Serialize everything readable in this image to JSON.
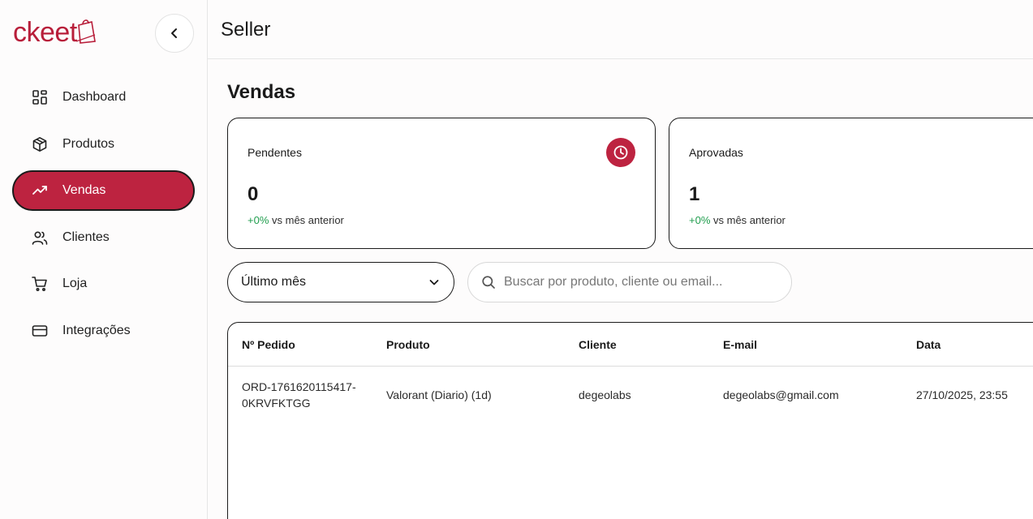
{
  "brand": {
    "name": "ckeet",
    "accent": "#bd2340"
  },
  "sidebar": {
    "items": [
      {
        "label": "Dashboard",
        "icon": "dashboard-icon"
      },
      {
        "label": "Produtos",
        "icon": "package-icon"
      },
      {
        "label": "Vendas",
        "icon": "trending-up-icon",
        "active": true
      },
      {
        "label": "Clientes",
        "icon": "users-icon"
      },
      {
        "label": "Loja",
        "icon": "cart-icon"
      },
      {
        "label": "Integrações",
        "icon": "credit-card-icon"
      }
    ]
  },
  "header": {
    "title": "Seller"
  },
  "main": {
    "title": "Vendas",
    "cards": [
      {
        "label": "Pendentes",
        "value": "0",
        "delta": "+0%",
        "delta_suffix": "vs mês anterior",
        "icon": "clock-icon"
      },
      {
        "label": "Aprovadas",
        "value": "1",
        "delta": "+0%",
        "delta_suffix": "vs mês anterior"
      }
    ],
    "filter": {
      "selected": "Último mês"
    },
    "search": {
      "placeholder": "Buscar por produto, cliente ou email..."
    },
    "table": {
      "columns": [
        "Nº Pedido",
        "Produto",
        "Cliente",
        "E-mail",
        "Data"
      ],
      "rows": [
        {
          "order_line1": "ORD-1761620115417-",
          "order_line2": "0KRVFKTGG",
          "product": "Valorant (Diario) (1d)",
          "client": "degeolabs",
          "email": "degeolabs@gmail.com",
          "date": "27/10/2025, 23:55"
        }
      ]
    }
  }
}
